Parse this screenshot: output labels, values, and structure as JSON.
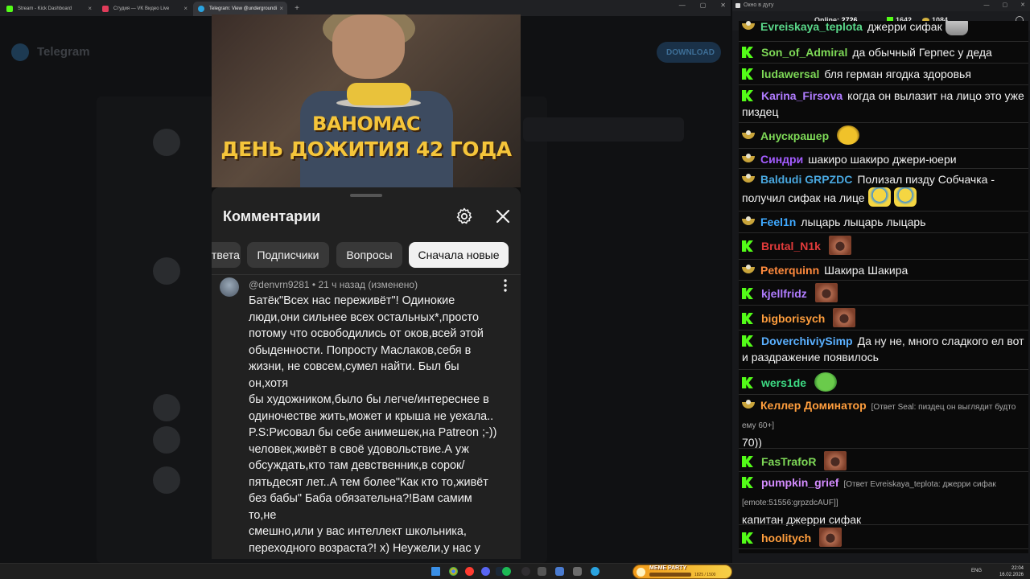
{
  "browser": {
    "tabs": [
      {
        "title": "Stream - Kick Dashboard",
        "fav_color": "#53fc18"
      },
      {
        "title": "Студия — VK Видео Live",
        "fav_color": "#e03c5a"
      },
      {
        "title": "Telegram: View @undergroundi",
        "fav_color": "#2aa3e0",
        "active": true
      }
    ],
    "new_tab": "+",
    "close_glyph": "×"
  },
  "telegram_bg": {
    "app_name": "Telegram",
    "download_label": "DOWNLOAD"
  },
  "video": {
    "title_line1": "ВАНОМАС",
    "title_line2": "ДЕНЬ ДОЖИТИЯ 42 ГОДА"
  },
  "comments": {
    "header": "Комментарии",
    "chips": [
      "Ответа",
      "Подписчики",
      "Вопросы",
      "Сначала новые"
    ],
    "selected_chip": "Сначала новые",
    "items": [
      {
        "author_meta": "@denvrn9281 • 21 ч назад (изменено)",
        "text": "Батёк\"Всех нас переживёт\"! Одинокие\nлюди,они сильнее всех остальных*,просто\nпотому что освободились от оков,всей этой\nобыденности. Попросту Маслаков,себя в\nжизни, не совсем,сумел найти. Был бы он,хотя\nбы художником,было бы легче/интереснее в\nодиночестве жить,может и крыша не уехала..\nP.S:Рисовал бы себе анимешек,на Patreon ;-))\nчеловек,живёт в своё удовольствие.А уж\nобсуждать,кто там девственник,в сорок/\nпятьдесят лет..А тем более\"Как кто то,живёт\nбез бабы\" Баба обязательна?!Вам самим то,не\nсмешно,или у вас интеллект школьника,\nпереходного возраста?! х) Неужели,у нас у\nвсех,своей жизни нет?Как говориться:Живи,и\nдай жить другим))"
      }
    ]
  },
  "chat_window": {
    "title": "Окно в дугу",
    "online_label": "Online:",
    "online_count": "2726",
    "kick_count": "1642",
    "vk_count": "1084"
  },
  "chat": {
    "messages": [
      {
        "platform": "vk",
        "nick": "Evreiskaya_teplota",
        "color": "#5ad88a",
        "text": "джерри сифак",
        "emote": "em-silver"
      },
      {
        "platform": "kick",
        "nick": "Son_of_Admiral",
        "color": "#7ed957",
        "text": "да обычный Герпес у деда"
      },
      {
        "platform": "kick",
        "nick": "ludawersal",
        "color": "#7ed957",
        "text": "бля герман ягодка здоровья"
      },
      {
        "platform": "kick",
        "nick": "Karina_Firsova",
        "color": "#b07cff",
        "text": "когда он вылазит на лицо это уже пиздец"
      },
      {
        "platform": "vk",
        "nick": "Анускрашер",
        "color": "#7ed957",
        "text": "",
        "emote": "em-jerry"
      },
      {
        "platform": "vk",
        "nick": "Синдри",
        "color": "#a35cff",
        "text": "шакиро шакиро джери-юери"
      },
      {
        "platform": "vk",
        "nick": "Baldudi GRPZDC",
        "color": "#49a8e0",
        "text": "Полизал пизду Собчачка - получил сифак на лице",
        "emote": "em-laugh",
        "emote2": "em-laugh"
      },
      {
        "platform": "vk",
        "nick": "Feel1n",
        "color": "#3fa9ff",
        "text": "лыцарь лыцарь лыцарь"
      },
      {
        "platform": "kick",
        "nick": "Brutal_N1k",
        "color": "#e23b3b",
        "text": "",
        "emote": "em-face"
      },
      {
        "platform": "vk",
        "nick": "Peterquinn",
        "color": "#ff8a3d",
        "text": "Шакира Шакира"
      },
      {
        "platform": "kick",
        "nick": "kjellfridz",
        "color": "#b07cff",
        "text": "",
        "emote": "em-face"
      },
      {
        "platform": "kick",
        "nick": "bigborisych",
        "color": "#ff9e3d",
        "text": "",
        "emote": "em-face"
      },
      {
        "platform": "kick",
        "nick": "DoverchiviySimp",
        "color": "#5ab0ff",
        "text": "Да ну не, много сладкого ел вот и раздражение появилось"
      },
      {
        "platform": "kick",
        "nick": "wers1de",
        "color": "#3ddc84",
        "text": "",
        "emote": "em-frog"
      },
      {
        "platform": "vk",
        "nick": "Келлер Доминатор",
        "color": "#ff9e3d",
        "reply": "[Ответ Seal: пиздец он выглядит будто ему 60+]",
        "text": "70))"
      },
      {
        "platform": "kick",
        "nick": "FasTrafoR",
        "color": "#7ed957",
        "text": "",
        "emote": "em-face"
      },
      {
        "platform": "kick",
        "nick": "pumpkin_grief",
        "color": "#d48cff",
        "reply": "[Ответ Evreiskaya_teplota: джерри сифак [emote:51556:grpzdcAUF]]",
        "text": "капитан джерри сифак"
      },
      {
        "platform": "kick",
        "nick": "hoolitych",
        "color": "#ff9e3d",
        "text": "",
        "emote": "em-face"
      }
    ]
  },
  "taskbar": {
    "widget_title": "MEME PARTY",
    "widget_count": "1825 / 1500",
    "lang": "ENG",
    "time": "22:04",
    "date": "16.02.2026"
  }
}
